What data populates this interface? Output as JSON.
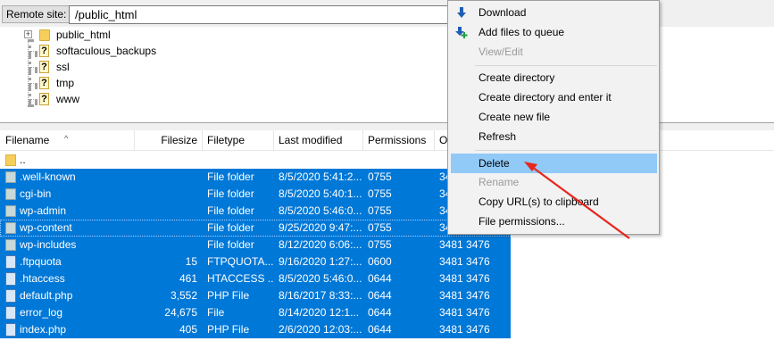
{
  "site_bar": {
    "label": "Remote site:",
    "path": "/public_html"
  },
  "tree": {
    "items": [
      {
        "label": "public_html",
        "icon": "folder-icon",
        "expander": "+"
      },
      {
        "label": "softaculous_backups",
        "icon": "unknown-folder-icon"
      },
      {
        "label": "ssl",
        "icon": "unknown-folder-icon"
      },
      {
        "label": "tmp",
        "icon": "unknown-folder-icon"
      },
      {
        "label": "www",
        "icon": "unknown-folder-icon"
      }
    ]
  },
  "file_list": {
    "columns": [
      "Filename",
      "Filesize",
      "Filetype",
      "Last modified",
      "Permissions",
      "O"
    ],
    "parent_row": "..",
    "rows": [
      {
        "name": ".well-known",
        "size": "",
        "type": "File folder",
        "modified": "8/5/2020 5:41:2...",
        "perms": "0755",
        "owner": "3481 3476",
        "icon": "folder"
      },
      {
        "name": "cgi-bin",
        "size": "",
        "type": "File folder",
        "modified": "8/5/2020 5:40:1...",
        "perms": "0755",
        "owner": "3481 3476",
        "icon": "folder"
      },
      {
        "name": "wp-admin",
        "size": "",
        "type": "File folder",
        "modified": "8/5/2020 5:46:0...",
        "perms": "0755",
        "owner": "3481 3476",
        "icon": "folder"
      },
      {
        "name": "wp-content",
        "size": "",
        "type": "File folder",
        "modified": "9/25/2020 9:47:...",
        "perms": "0755",
        "owner": "3481 3476",
        "icon": "folder"
      },
      {
        "name": "wp-includes",
        "size": "",
        "type": "File folder",
        "modified": "8/12/2020 6:06:...",
        "perms": "0755",
        "owner": "3481 3476",
        "icon": "folder"
      },
      {
        "name": ".ftpquota",
        "size": "15",
        "type": "FTPQUOTA...",
        "modified": "9/16/2020 1:27:...",
        "perms": "0600",
        "owner": "3481 3476",
        "icon": "file"
      },
      {
        "name": ".htaccess",
        "size": "461",
        "type": "HTACCESS ...",
        "modified": "8/5/2020 5:46:0...",
        "perms": "0644",
        "owner": "3481 3476",
        "icon": "file"
      },
      {
        "name": "default.php",
        "size": "3,552",
        "type": "PHP File",
        "modified": "8/16/2017 8:33:...",
        "perms": "0644",
        "owner": "3481 3476",
        "icon": "file"
      },
      {
        "name": "error_log",
        "size": "24,675",
        "type": "File",
        "modified": "8/14/2020 12:1...",
        "perms": "0644",
        "owner": "3481 3476",
        "icon": "file"
      },
      {
        "name": "index.php",
        "size": "405",
        "type": "PHP File",
        "modified": "2/6/2020 12:03:...",
        "perms": "0644",
        "owner": "3481 3476",
        "icon": "file"
      }
    ]
  },
  "context_menu": {
    "items": [
      {
        "label": "Download",
        "icon": "download-arrow-icon",
        "enabled": true
      },
      {
        "label": "Add files to queue",
        "icon": "add-to-queue-icon",
        "enabled": true
      },
      {
        "label": "View/Edit",
        "enabled": false
      },
      {
        "label": "Create directory",
        "enabled": true
      },
      {
        "label": "Create directory and enter it",
        "enabled": true
      },
      {
        "label": "Create new file",
        "enabled": true
      },
      {
        "label": "Refresh",
        "enabled": true
      },
      {
        "label": "Delete",
        "enabled": true,
        "highlighted": true
      },
      {
        "label": "Rename",
        "enabled": false
      },
      {
        "label": "Copy URL(s) to clipboard",
        "enabled": true
      },
      {
        "label": "File permissions...",
        "enabled": true
      }
    ]
  },
  "colors": {
    "selection": "#0078d7",
    "menu_hover": "#91c9f7",
    "annotation_arrow": "#e8261e"
  }
}
